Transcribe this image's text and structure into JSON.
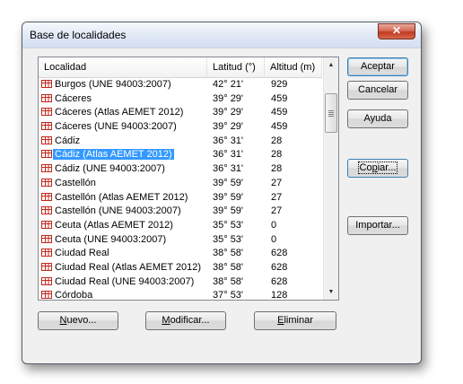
{
  "dialog": {
    "title": "Base de localidades",
    "close_label": "✕"
  },
  "list": {
    "columns": {
      "localidad": "Localidad",
      "latitud": "Latitud (°)",
      "altitud": "Altitud (m)"
    },
    "rows": [
      {
        "name": "Burgos (UNE 94003:2007)",
        "lat": "42° 21'",
        "alt": "929",
        "selected": false
      },
      {
        "name": "Cáceres",
        "lat": "39° 29'",
        "alt": "459",
        "selected": false
      },
      {
        "name": "Cáceres (Atlas AEMET 2012)",
        "lat": "39° 29'",
        "alt": "459",
        "selected": false
      },
      {
        "name": "Cáceres (UNE 94003:2007)",
        "lat": "39° 29'",
        "alt": "459",
        "selected": false
      },
      {
        "name": "Cádiz",
        "lat": "36° 31'",
        "alt": "28",
        "selected": false
      },
      {
        "name": "Cádiz (Atlas AEMET 2012)",
        "lat": "36° 31'",
        "alt": "28",
        "selected": true
      },
      {
        "name": "Cádiz (UNE 94003:2007)",
        "lat": "36° 31'",
        "alt": "28",
        "selected": false
      },
      {
        "name": "Castellón",
        "lat": "39° 59'",
        "alt": "27",
        "selected": false
      },
      {
        "name": "Castellón (Atlas AEMET 2012)",
        "lat": "39° 59'",
        "alt": "27",
        "selected": false
      },
      {
        "name": "Castellón (UNE 94003:2007)",
        "lat": "39° 59'",
        "alt": "27",
        "selected": false
      },
      {
        "name": "Ceuta  (Atlas AEMET 2012)",
        "lat": "35° 53'",
        "alt": "0",
        "selected": false
      },
      {
        "name": "Ceuta  (UNE 94003:2007)",
        "lat": "35° 53'",
        "alt": "0",
        "selected": false
      },
      {
        "name": "Ciudad Real",
        "lat": "38° 58'",
        "alt": "628",
        "selected": false
      },
      {
        "name": "Ciudad Real (Atlas AEMET 2012)",
        "lat": "38° 58'",
        "alt": "628",
        "selected": false
      },
      {
        "name": "Ciudad Real (UNE 94003:2007)",
        "lat": "38° 58'",
        "alt": "628",
        "selected": false
      },
      {
        "name": "Córdoba",
        "lat": "37° 53'",
        "alt": "128",
        "selected": false
      }
    ],
    "row_icon": "location-table-icon"
  },
  "buttons": {
    "aceptar": "Aceptar",
    "cancelar": "Cancelar",
    "ayuda": "Ayuda",
    "copiar": {
      "pre": "Co",
      "key": "p",
      "post": "iar..."
    },
    "importar": "Importar...",
    "nuevo": {
      "pre": "",
      "key": "N",
      "post": "uevo..."
    },
    "modificar": {
      "pre": "",
      "key": "M",
      "post": "odificar..."
    },
    "eliminar": {
      "pre": "",
      "key": "E",
      "post": "liminar"
    }
  },
  "colors": {
    "selection": "#3399ff",
    "close_button": "#c13a22",
    "icon_red": "#c0281c"
  }
}
